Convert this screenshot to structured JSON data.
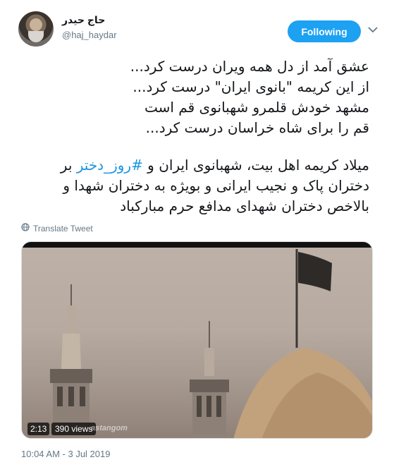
{
  "author": {
    "display_name": "حاج حیدر",
    "handle": "@haj_haydar",
    "avatar_icon": "user-avatar"
  },
  "follow_button": {
    "label": "Following",
    "color": "#1da1f2"
  },
  "more_icon": "chevron-down-icon",
  "tweet": {
    "lines_block1": [
      "عشق آمد از دل همه ویران درست کرد...",
      "از این کریمه \"بانوی ایران\" درست کرد...",
      "مشهد خودش قلمرو شهبانوی قم است",
      "قم را برای شاه خراسان درست کرد..."
    ],
    "line5_prefix": "میلاد کریمه اهل بیت، شهبانوی ایران و ",
    "hashtag": "#روز_دختر",
    "line5_suffix": " بر",
    "line6": "دختران پاک و نجیب ایرانی و بویژه به دختران شهدا و",
    "line7": "بالاخص دختران شهدای مدافع حرم مبارکباد",
    "hashtag_color": "#1b95e0"
  },
  "translate": {
    "label": "Translate Tweet",
    "icon": "globe-icon"
  },
  "media": {
    "duration": "2:13",
    "views": "390 views",
    "watermark": "astangom"
  },
  "timestamp": "10:04 AM - 3 Jul 2019"
}
